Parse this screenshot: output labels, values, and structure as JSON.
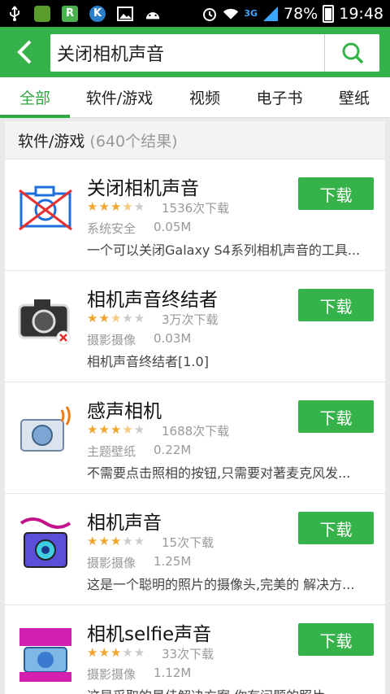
{
  "status_bar": {
    "battery": "78%",
    "time": "19:48",
    "network": "3G"
  },
  "search": {
    "query": "关闭相机声音"
  },
  "tabs": [
    {
      "label": "全部",
      "active": true
    },
    {
      "label": "软件/游戏"
    },
    {
      "label": "视频"
    },
    {
      "label": "电子书"
    },
    {
      "label": "壁纸"
    }
  ],
  "results": {
    "section_title": "软件/游戏",
    "count_text": "(640个结果)",
    "download_label": "下载",
    "items": [
      {
        "name": "关闭相机声音",
        "rating": 3.5,
        "downloads": "1536次下载",
        "category": "系统安全",
        "size": "0.05M",
        "description": "一个可以关闭Galaxy S4系列相机声音的工具..."
      },
      {
        "name": "相机声音终结者",
        "rating": 2.5,
        "downloads": "3万次下载",
        "category": "摄影摄像",
        "size": "0.03M",
        "description": "相机声音终结者[1.0]"
      },
      {
        "name": "感声相机",
        "rating": 3.5,
        "downloads": "1688次下载",
        "category": "主题壁纸",
        "size": "0.22M",
        "description": "不需要点击照相的按钮,只需要对著麦克风发..."
      },
      {
        "name": "相机声音",
        "rating": 3,
        "downloads": "15次下载",
        "category": "摄影摄像",
        "size": "1.25M",
        "description": "这是一个聪明的照片的摄像头,完美的 解决方..."
      },
      {
        "name": "相机selfie声音",
        "rating": 3,
        "downloads": "33次下载",
        "category": "摄影摄像",
        "size": "1.12M",
        "description": "这是采取的最佳解决方案,你有问题的照片..."
      }
    ]
  },
  "colors": {
    "accent": "#35b34a",
    "star": "#f1a52e"
  }
}
